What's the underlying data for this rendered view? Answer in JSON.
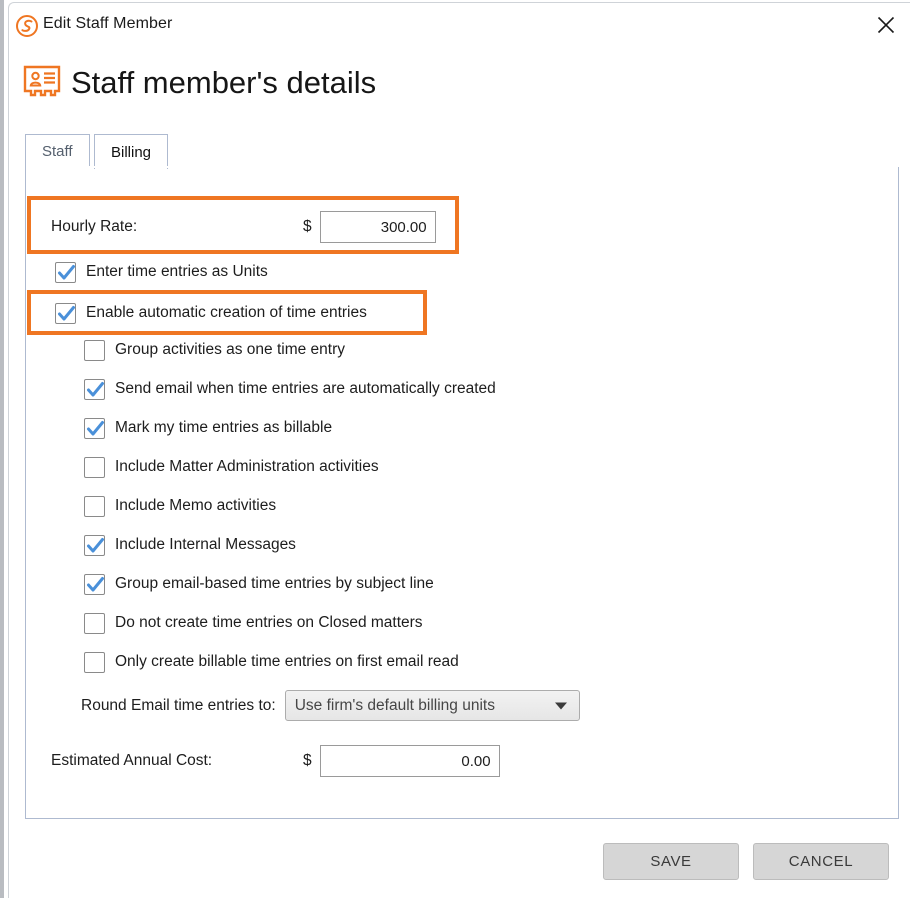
{
  "window": {
    "title": "Edit Staff Member",
    "logo_icon": "smokeball-s-logo-icon",
    "close_icon": "close-icon"
  },
  "page": {
    "heading": "Staff member's details",
    "heading_icon": "id-card-icon"
  },
  "tabs": [
    {
      "label": "Staff",
      "active": false
    },
    {
      "label": "Billing",
      "active": true
    }
  ],
  "billing": {
    "hourly_rate": {
      "label": "Hourly Rate:",
      "currency_symbol": "$",
      "value": "300.00",
      "highlighted": true
    },
    "checkboxes": [
      {
        "label": "Enter time entries as Units",
        "checked": true,
        "indent": 0,
        "highlighted": false
      },
      {
        "label": "Enable automatic creation of time entries",
        "checked": true,
        "indent": 0,
        "highlighted": true
      },
      {
        "label": "Group activities as one time entry",
        "checked": false,
        "indent": 1,
        "highlighted": false
      },
      {
        "label": "Send email when time entries are automatically created",
        "checked": true,
        "indent": 1,
        "highlighted": false
      },
      {
        "label": "Mark my time entries as billable",
        "checked": true,
        "indent": 1,
        "highlighted": false
      },
      {
        "label": "Include Matter Administration activities",
        "checked": false,
        "indent": 1,
        "highlighted": false
      },
      {
        "label": "Include Memo activities",
        "checked": false,
        "indent": 1,
        "highlighted": false
      },
      {
        "label": "Include Internal Messages",
        "checked": true,
        "indent": 1,
        "highlighted": false
      },
      {
        "label": "Group email-based time entries by subject line",
        "checked": true,
        "indent": 1,
        "highlighted": false
      },
      {
        "label": "Do not create time entries on Closed matters",
        "checked": false,
        "indent": 1,
        "highlighted": false
      },
      {
        "label": "Only create billable time entries on first email read",
        "checked": false,
        "indent": 1,
        "highlighted": false
      }
    ],
    "round_email": {
      "label": "Round Email time entries to:",
      "selected": "Use firm's default billing units",
      "arrow_icon": "chevron-down-icon"
    },
    "estimated_annual_cost": {
      "label": "Estimated Annual Cost:",
      "currency_symbol": "$",
      "value": "0.00"
    }
  },
  "footer": {
    "save_label": "SAVE",
    "cancel_label": "CANCEL"
  },
  "colors": {
    "accent_orange": "#ef7622",
    "checkbox_check_blue": "#4a90d9",
    "tab_border": "#aebad0"
  }
}
